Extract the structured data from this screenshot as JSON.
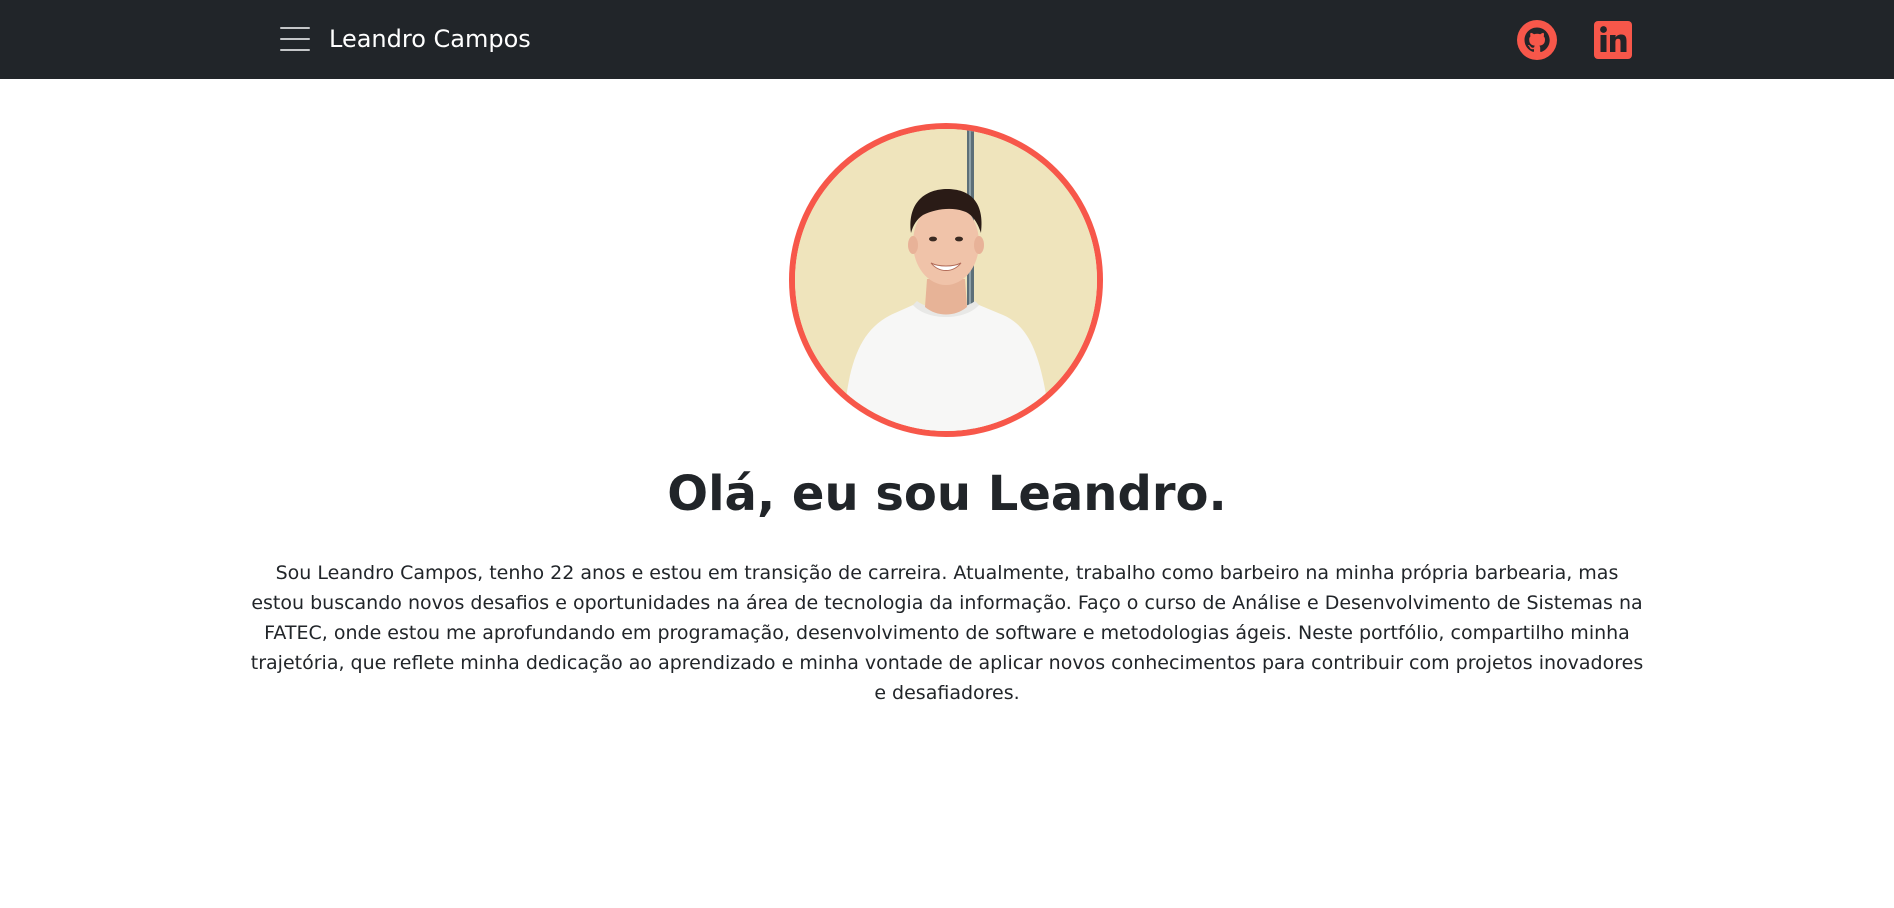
{
  "navbar": {
    "menu_icon": "hamburger-menu-icon",
    "brand": "Leandro Campos",
    "social": [
      {
        "name": "GitHub",
        "icon": "github-icon"
      },
      {
        "name": "LinkedIn",
        "icon": "linkedin-icon"
      }
    ],
    "background_color": "#212529",
    "accent_color": "#f7574a"
  },
  "hero": {
    "avatar_icon": "profile-photo",
    "title": "Olá, eu sou Leandro.",
    "description": "Sou Leandro Campos, tenho 22 anos e estou em transição de carreira. Atualmente, trabalho como barbeiro na minha própria barbearia, mas estou buscando novos desafios e oportunidades na área de tecnologia da informação. Faço o curso de Análise e Desenvolvimento de Sistemas na FATEC, onde estou me aprofundando em programação, desenvolvimento de software e metodologias ágeis. Neste portfólio, compartilho minha trajetória, que reflete minha dedicação ao aprendizado e minha vontade de aplicar novos conhecimentos para contribuir com projetos inovadores e desafiadores."
  }
}
